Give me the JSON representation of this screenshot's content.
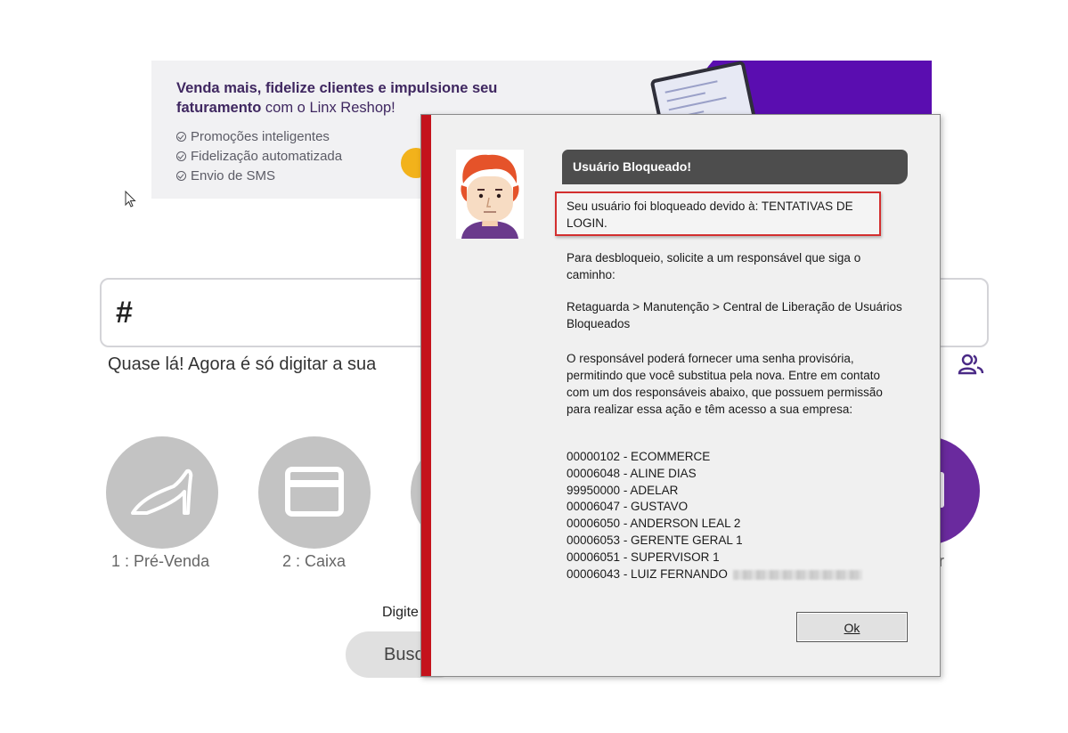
{
  "banner": {
    "headline_bold": "Venda mais, fidelize clientes e impulsione seu faturamento",
    "headline_rest": " com o Linx Reshop!",
    "bullets": [
      "Promoções inteligentes",
      "Fidelização automatizada",
      "Envio de SMS"
    ]
  },
  "login": {
    "input_value": "#",
    "hint": "Quase lá! Agora é só digitar a sua",
    "modules": [
      {
        "label": "1 : Pré-Venda",
        "icon": "high-heel-icon"
      },
      {
        "label": "2 : Caixa",
        "icon": "card-icon"
      }
    ],
    "right_label_fragment": "ir",
    "digite_label": "Digite",
    "busca_button_label": "Busc"
  },
  "dialog": {
    "title": "Usuário Bloqueado!",
    "blocked_reason": "Seu usuário foi bloqueado devido à: TENTATIVAS DE LOGIN.",
    "unlock_instruction": "Para desbloqueio, solicite a um responsável que siga o caminho:",
    "unlock_path": "Retaguarda > Manutenção > Central de Liberação de Usuários Bloqueados",
    "provisional_info": "O responsável poderá fornecer uma senha provisória, permitindo que você substitua pela nova. Entre em contato com um dos responsáveis abaixo, que possuem permissão para realizar essa ação e têm acesso a sua empresa:",
    "responsaveis": [
      "00000102 - ECOMMERCE",
      "00006048 - ALINE DIAS",
      "99950000 - ADELAR",
      "00006047 - GUSTAVO",
      "00006050 - ANDERSON LEAL 2",
      "00006053 - GERENTE GERAL 1",
      "00006051 - SUPERVISOR 1",
      "00006043 - LUIZ FERNANDO"
    ],
    "ok_label": "Ok"
  },
  "colors": {
    "accent_purple": "#5a0db0",
    "dialog_strip": "#c4131c",
    "highlight_border": "#d32f2f",
    "title_bar": "#4d4d4d"
  }
}
